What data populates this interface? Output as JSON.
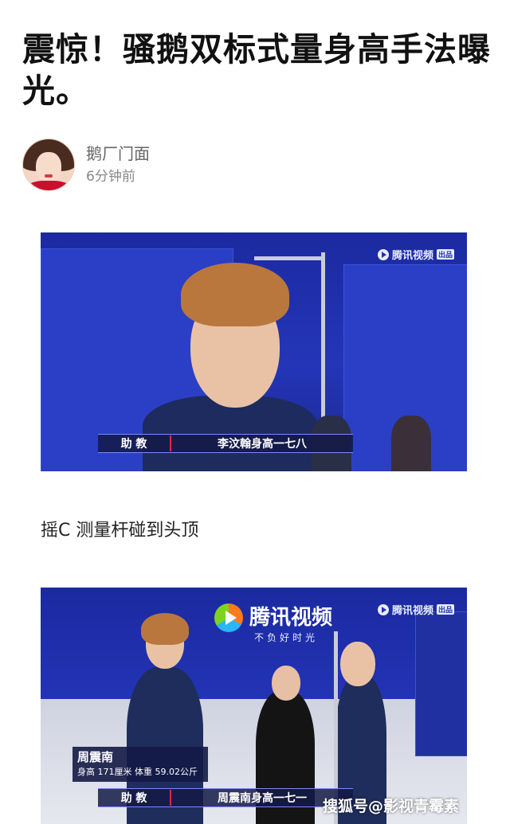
{
  "article": {
    "title": "震惊！骚鹅双标式量身高手法曝光。",
    "author_name": "鹅厂门面",
    "time": "6分钟前",
    "paragraph": "摇C 测量杆碰到头顶"
  },
  "photo1": {
    "watermark": "腾讯视频",
    "watermark_tag": "出品",
    "caption_role": "助  教",
    "caption_text": "李汶翰身高一七八"
  },
  "photo2": {
    "watermark": "腾讯视频",
    "watermark_tag": "出品",
    "brand_name": "腾讯视频",
    "brand_slogan": "不负好时光",
    "player_name": "周震南",
    "player_height": "身高 171厘米",
    "player_weight": "体重 59.02公斤",
    "caption_role": "助  教",
    "caption_text": "周震南身高一七一",
    "footer_watermark": "搜狐号@影视青霉素"
  }
}
